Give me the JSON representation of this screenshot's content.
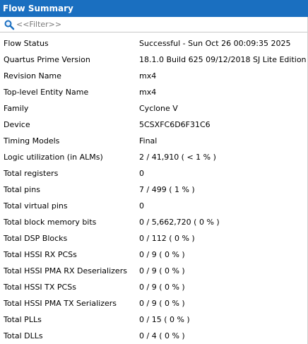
{
  "window": {
    "title": "Flow Summary"
  },
  "filter": {
    "placeholder": "<<Filter>>",
    "value": ""
  },
  "rows": [
    {
      "key": "Flow Status",
      "value": "Successful - Sun Oct 26 00:09:35 2025"
    },
    {
      "key": "Quartus Prime Version",
      "value": "18.1.0 Build 625 09/12/2018 SJ Lite Edition"
    },
    {
      "key": "Revision Name",
      "value": "mx4"
    },
    {
      "key": "Top-level Entity Name",
      "value": "mx4"
    },
    {
      "key": "Family",
      "value": "Cyclone V"
    },
    {
      "key": "Device",
      "value": "5CSXFC6D6F31C6"
    },
    {
      "key": "Timing Models",
      "value": "Final"
    },
    {
      "key": "Logic utilization (in ALMs)",
      "value": "2 / 41,910 ( < 1 % )"
    },
    {
      "key": "Total registers",
      "value": "0"
    },
    {
      "key": "Total pins",
      "value": "7 / 499 ( 1 % )"
    },
    {
      "key": "Total virtual pins",
      "value": "0"
    },
    {
      "key": "Total block memory bits",
      "value": "0 / 5,662,720 ( 0 % )"
    },
    {
      "key": "Total DSP Blocks",
      "value": "0 / 112 ( 0 % )"
    },
    {
      "key": "Total HSSI RX PCSs",
      "value": "0 / 9 ( 0 % )"
    },
    {
      "key": "Total HSSI PMA RX Deserializers",
      "value": "0 / 9 ( 0 % )"
    },
    {
      "key": "Total HSSI TX PCSs",
      "value": "0 / 9 ( 0 % )"
    },
    {
      "key": "Total HSSI PMA TX Serializers",
      "value": "0 / 9 ( 0 % )"
    },
    {
      "key": "Total PLLs",
      "value": "0 / 15 ( 0 % )"
    },
    {
      "key": "Total DLLs",
      "value": "0 / 4 ( 0 % )"
    }
  ],
  "icons": {
    "filter": "search-icon"
  },
  "colors": {
    "title_bar": "#1a6fc0",
    "title_text": "#ffffff",
    "filter_text": "#7a7a7a"
  }
}
